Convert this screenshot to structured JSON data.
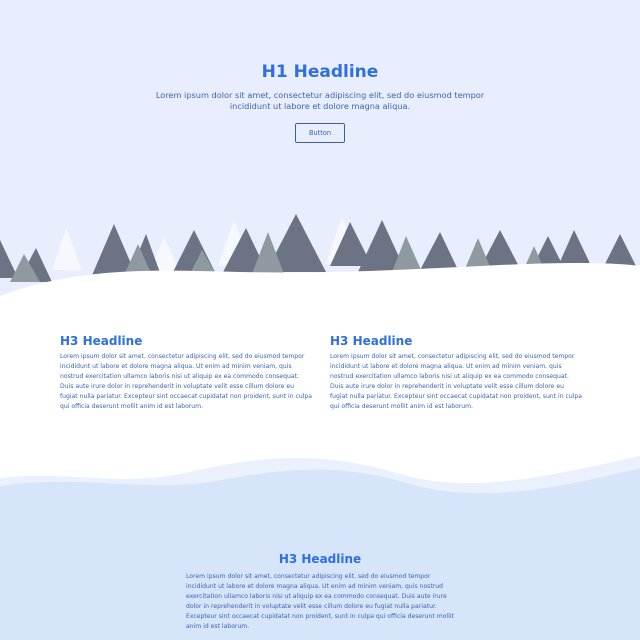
{
  "hero": {
    "title": "H1 Headline",
    "subtitle": "Lorem ipsum dolor sit amet, consectetur adipiscing elit, sed do eiusmod tempor incididunt ut labore et dolore magna aliqua.",
    "button_label": "Button"
  },
  "features": [
    {
      "title": "H3 Headline",
      "body": "Lorem ipsum dolor sit amet, consectetur adipiscing elit, sed do eiusmod tempor incididunt ut labore et dolore magna aliqua. Ut enim ad minim veniam, quis nostrud exercitation ullamco laboris nisi ut aliquip ex ea commodo consequat. Duis aute irure dolor in reprehenderit in voluptate velit esse cillum dolore eu fugiat nulla pariatur. Excepteur sint occaecat cupidatat non proident, sunt in culpa qui officia deserunt mollit anim id est laborum."
    },
    {
      "title": "H3 Headline",
      "body": "Lorem ipsum dolor sit amet, consectetur adipiscing elit, sed do eiusmod tempor incididunt ut labore et dolore magna aliqua. Ut enim ad minim veniam, quis nostrud exercitation ullamco laboris nisi ut aliquip ex ea commodo consequat. Duis aute irure dolor in reprehenderit in voluptate velit esse cillum dolore eu fugiat nulla pariatur. Excepteur sint occaecat cupidatat non proident, sunt in culpa qui officia deserunt mollit anim id est laborum."
    }
  ],
  "footer": {
    "title": "H3 Headline",
    "body": "Lorem ipsum dolor sit amet, consectetur adipiscing elit, sed do eiusmod tempor incididunt ut labore et dolore magna aliqua. Ut enim ad minim veniam, quis nostrud exercitation ullamco laboris nisi ut aliquip ex ea commodo consequat. Duis aute irure dolor in reprehenderit in voluptate velit esse cillum dolore eu fugiat nulla pariatur. Excepteur sint occaecat cupidatat non proident, sunt in culpa qui officia deserunt mollit anim id est laborum."
  },
  "colors": {
    "hero_bg": "#e9eefe",
    "accent": "#2f6fe0",
    "text": "#3a64b0",
    "tree_dark": "#6b7384",
    "tree_mid": "#8f9aa0",
    "tree_light": "#f6f8fe",
    "footer_bg": "#d7e5fb"
  }
}
